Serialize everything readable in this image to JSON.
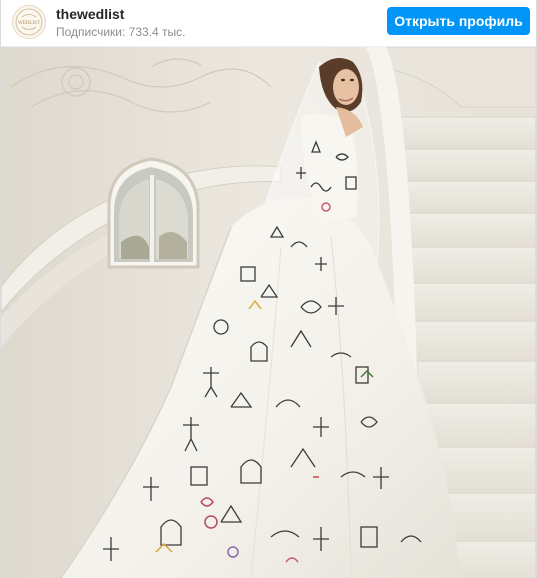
{
  "header": {
    "username": "thewedlist",
    "followers": "Подписчики: 733.4 тыс.",
    "open_profile_label": "Открыть профиль",
    "avatar_text": "WEDLIST"
  },
  "post": {
    "image_description_icon": "wedding-dress-photo"
  },
  "colors": {
    "accent": "#0095f6",
    "username": "#262626",
    "secondary": "#8e8e8e"
  }
}
